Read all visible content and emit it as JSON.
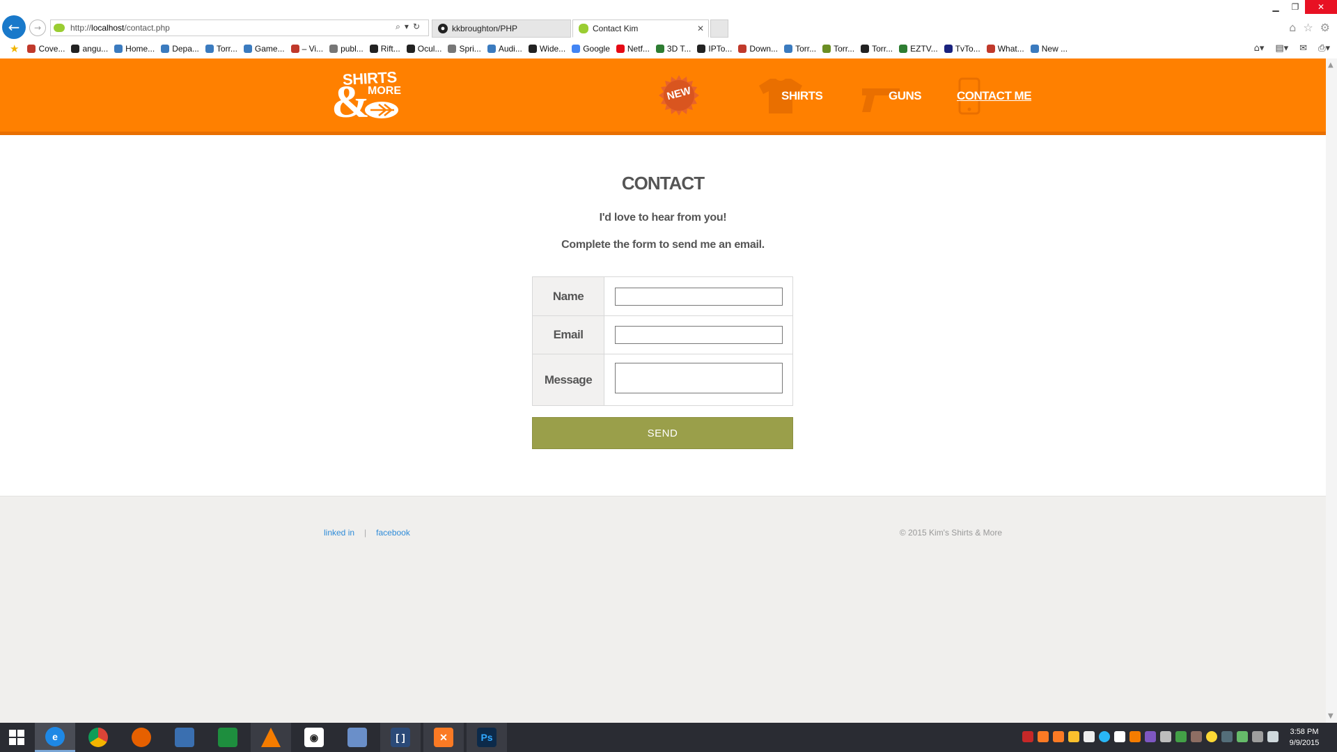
{
  "browser": {
    "url_prefix": "http://",
    "url_host": "localhost",
    "url_path": "/contact.php",
    "tabs": [
      {
        "label": "kkbroughton/PHP",
        "active": false
      },
      {
        "label": "Contact Kim",
        "active": true
      }
    ],
    "favorites": [
      {
        "label": "Cove...",
        "color": "#c0392b"
      },
      {
        "label": "angu...",
        "color": "#222222"
      },
      {
        "label": "Home...",
        "color": "#3b7bbf"
      },
      {
        "label": "Depa...",
        "color": "#3b7bbf"
      },
      {
        "label": "Torr...",
        "color": "#3b7bbf"
      },
      {
        "label": "Game...",
        "color": "#3b7bbf"
      },
      {
        "label": "– Vi...",
        "color": "#c0392b"
      },
      {
        "label": "publ...",
        "color": "#777777"
      },
      {
        "label": "Rift...",
        "color": "#222222"
      },
      {
        "label": "Ocul...",
        "color": "#222222"
      },
      {
        "label": "Spri...",
        "color": "#777777"
      },
      {
        "label": "Audi...",
        "color": "#3b7bbf"
      },
      {
        "label": "Wide...",
        "color": "#222222"
      },
      {
        "label": "Google",
        "color": "#4285f4"
      },
      {
        "label": "Netf...",
        "color": "#e50914"
      },
      {
        "label": "3D T...",
        "color": "#2e7d32"
      },
      {
        "label": "IPTo...",
        "color": "#222222"
      },
      {
        "label": "Down...",
        "color": "#c0392b"
      },
      {
        "label": "Torr...",
        "color": "#3b7bbf"
      },
      {
        "label": "Torr...",
        "color": "#6b8e23"
      },
      {
        "label": "Torr...",
        "color": "#222222"
      },
      {
        "label": "EZTV...",
        "color": "#2e7d32"
      },
      {
        "label": "TvTo...",
        "color": "#1a237e"
      },
      {
        "label": "What...",
        "color": "#c0392b"
      },
      {
        "label": "New ...",
        "color": "#3b7bbf"
      }
    ]
  },
  "site": {
    "logo": {
      "line1": "SHIRTS",
      "line2": "MORE",
      "amp": "&"
    },
    "nav": {
      "new_label": "NEW",
      "shirts": "SHIRTS",
      "guns": "GUNS",
      "contact": "CONTACT ME"
    },
    "brand_color": "#ff8000",
    "button_color": "#9a9f4a"
  },
  "contact": {
    "title": "CONTACT",
    "subtitle1": "I'd love to hear from you!",
    "subtitle2": "Complete the form to send me an email.",
    "fields": {
      "name_label": "Name",
      "email_label": "Email",
      "message_label": "Message",
      "name_value": "",
      "email_value": "",
      "message_value": ""
    },
    "send_label": "SEND"
  },
  "footer": {
    "link1": "linked in",
    "separator": "|",
    "link2": "facebook",
    "copyright": "© 2015 Kim's Shirts & More"
  },
  "taskbar": {
    "clock_time": "3:58 PM",
    "clock_date": "9/9/2015"
  }
}
